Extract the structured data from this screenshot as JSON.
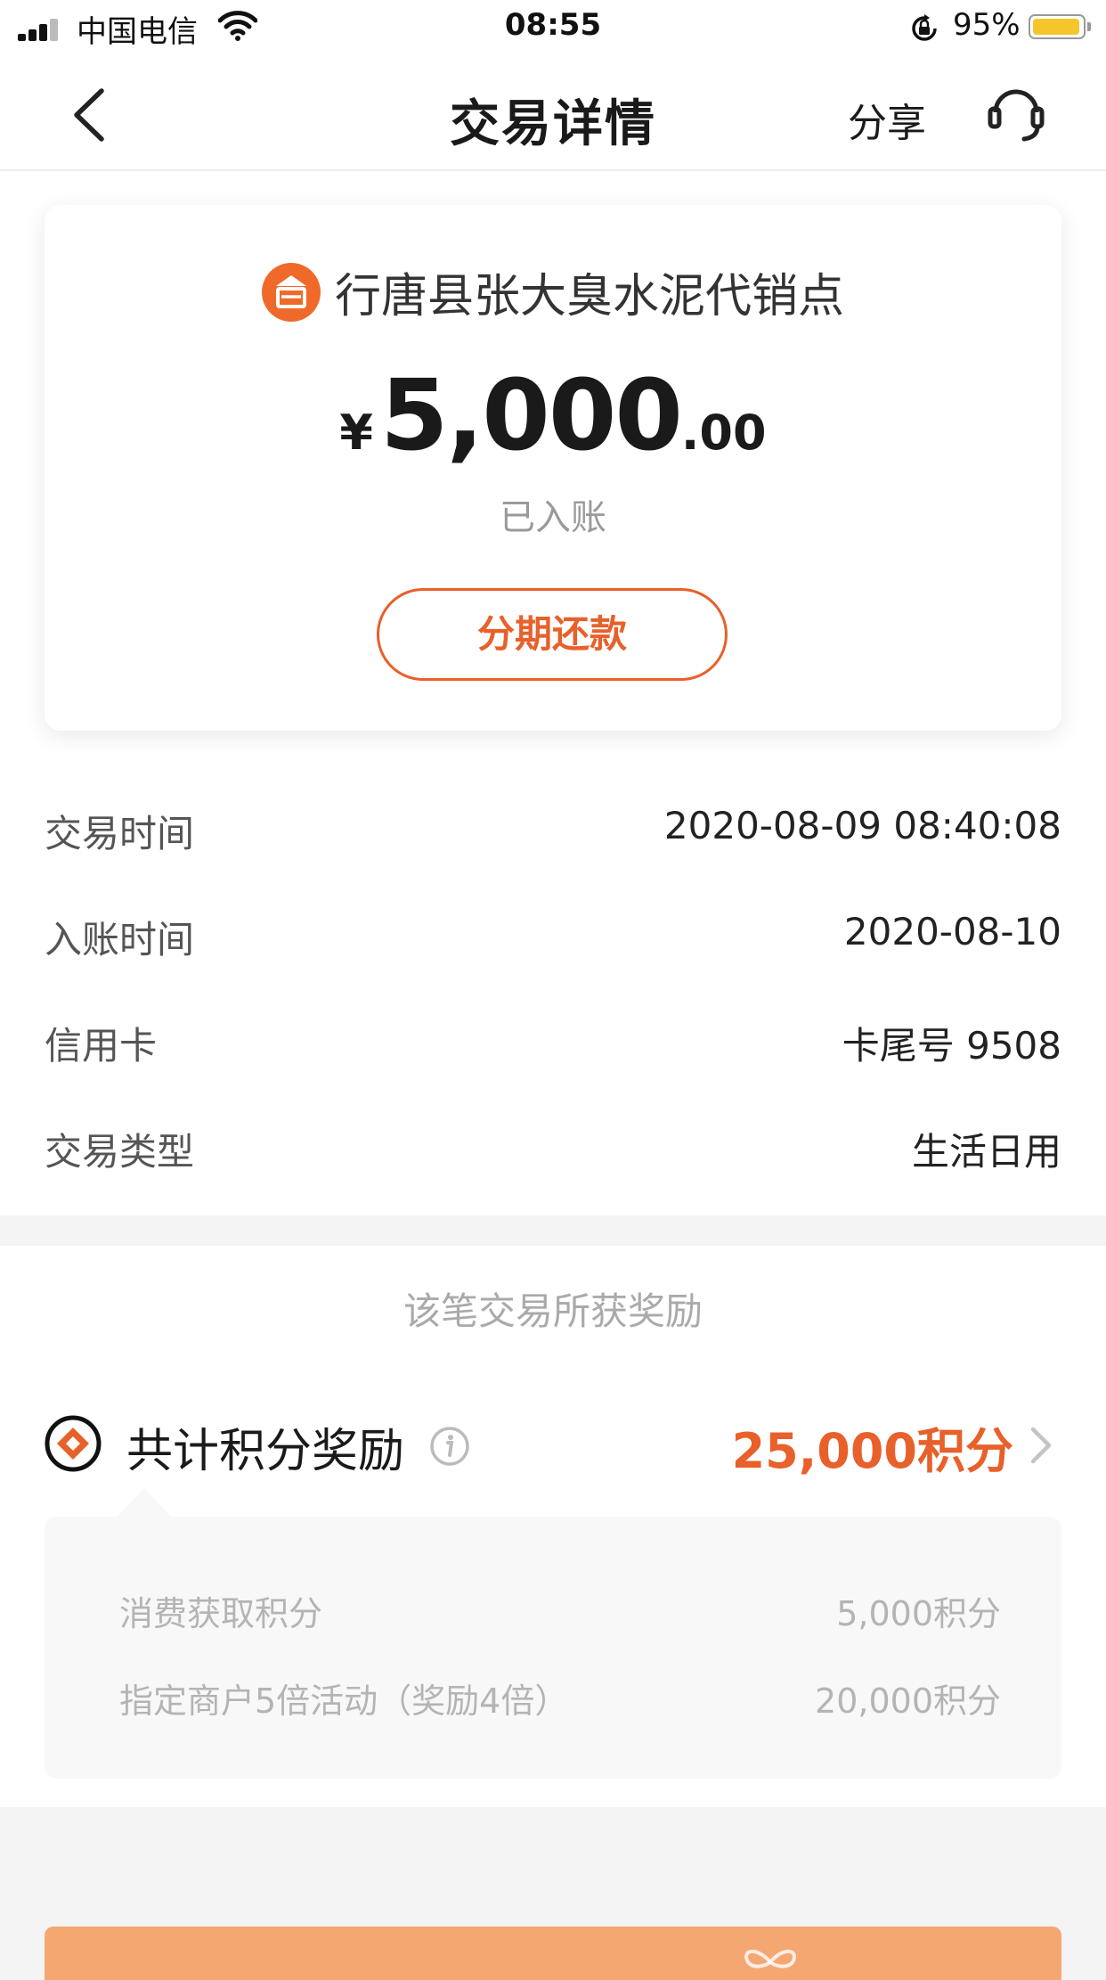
{
  "status_bar": {
    "carrier": "中国电信",
    "time": "08:55",
    "battery_percent": "95%",
    "battery_level": 0.95,
    "icons": [
      "signal-icon",
      "wifi-icon",
      "orientation-lock-icon",
      "battery-icon"
    ]
  },
  "nav": {
    "title": "交易详情",
    "share_label": "分享",
    "icons": [
      "back-icon",
      "customer-service-icon"
    ]
  },
  "transaction": {
    "merchant": "行唐县张大臭水泥代销点",
    "currency_symbol": "¥",
    "amount_integer": "5,000",
    "amount_decimal": ".00",
    "status": "已入账",
    "installment_button": "分期还款"
  },
  "details": [
    {
      "label": "交易时间",
      "value": "2020-08-09 08:40:08"
    },
    {
      "label": "入账时间",
      "value": "2020-08-10"
    },
    {
      "label": "信用卡",
      "value": "卡尾号 9508"
    },
    {
      "label": "交易类型",
      "value": "生活日用"
    }
  ],
  "rewards": {
    "heading": "该笔交易所获奖励",
    "total_label": "共计积分奖励",
    "total_value": "25,000积分",
    "breakdown": [
      {
        "label": "消费获取积分",
        "value": "5,000积分"
      },
      {
        "label": "指定商户5倍活动（奖励4倍）",
        "value": "20,000积分"
      }
    ]
  },
  "colors": {
    "accent": "#e8602a",
    "merchant_icon_bg": "#ef6a2a",
    "battery_fill": "#f5c62b",
    "banner": "#f5a772"
  }
}
